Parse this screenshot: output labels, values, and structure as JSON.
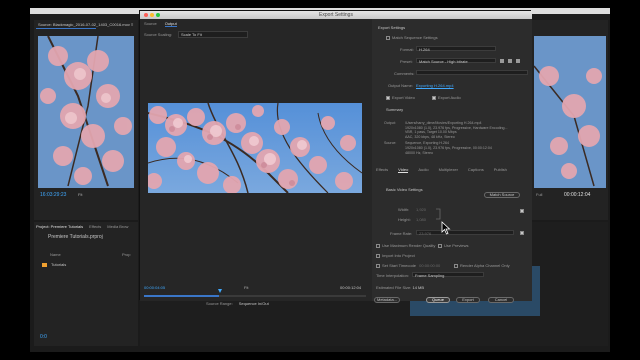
{
  "app": {
    "source_tab": "Source: Blackmagic_2016-07-02_1403_C0016.mov ≡",
    "source_timecode": "16:03:29:23",
    "source_zoom": "Fit",
    "project_tabs": [
      "Project: Premiere Tutorials",
      "Effects",
      "Media Brow"
    ],
    "project_file": "Premiere Tutorials.prproj",
    "project_col_name": "Name",
    "project_col_prop": "Prop",
    "project_folder": "Tutorials",
    "program_timecode": "00:00:12:04",
    "program_zoom": "Full",
    "timeline_timecode": "0:0"
  },
  "dialog": {
    "title": "Export Settings",
    "left": {
      "tabs": [
        "Source",
        "Output"
      ],
      "active_tab": "Output",
      "source_scaling_label": "Source Scaling:",
      "source_scaling_value": "Scale To Fit",
      "time_left": "00:00:04:05",
      "time_right": "00:00:12:04",
      "zoom": "Fit",
      "source_range_label": "Source Range:",
      "source_range_value": "Sequence In/Out",
      "scrub_progress": 0.34
    },
    "right": {
      "export_settings": "Export Settings",
      "match_sequence": "Match Sequence Settings",
      "format_label": "Format:",
      "format_value": "H.264",
      "preset_label": "Preset:",
      "preset_value": "Match Source - High bitrate",
      "comments_label": "Comments:",
      "output_name_label": "Output Name:",
      "output_name_value": "Exporting H.264.mp4",
      "export_video": "Export Video",
      "export_audio": "Export Audio",
      "summary_title": "Summary",
      "summary_output_label": "Output:",
      "summary_output_lines": [
        "/Users/harry_dime/Movies/Exporting H.264.mp4",
        "1920x1080 (1.0), 23.976 fps, Progressive, Hardware Encoding...",
        "VBR, 1 pass, Target 10.00 Mbps",
        "AAC, 320 kbps, 48 kHz, Stereo"
      ],
      "summary_source_label": "Source:",
      "summary_source_lines": [
        "Sequence, Exporting H.264",
        "1920x1080 (1.0), 23.976 fps, Progressive, 00:00:12:04",
        "48000 Hz, Stereo"
      ],
      "tabs": [
        "Effects",
        "Video",
        "Audio",
        "Multiplexer",
        "Captions",
        "Publish"
      ],
      "active_tab": "Video",
      "basic_video_settings": "Basic Video Settings",
      "match_source_button": "Match Source",
      "width_label": "Width:",
      "width_value": "1,920",
      "height_label": "Height:",
      "height_value": "1,080",
      "frame_rate_label": "Frame Rate:",
      "frame_rate_value": "23.976",
      "use_max_render": "Use Maximum Render Quality",
      "use_previews": "Use Previews",
      "import_into_project": "Import Into Project",
      "set_start_timecode": "Set Start Timecode",
      "start_timecode_value": "00:00:00:00",
      "render_alpha": "Render Alpha Channel Only",
      "time_interp_label": "Time Interpolation:",
      "time_interp_value": "Frame Sampling",
      "est_file_size_label": "Estimated File Size:",
      "est_file_size_value": "14 MB",
      "metadata_button": "Metadata...",
      "queue_button": "Queue",
      "export_button": "Export",
      "cancel_button": "Cancel"
    }
  },
  "colors": {
    "accent_blue": "#3fa9ff",
    "panel_bg": "#2c2c2c",
    "sky": "#5f94d6",
    "blossom": "#e3a6b0"
  }
}
